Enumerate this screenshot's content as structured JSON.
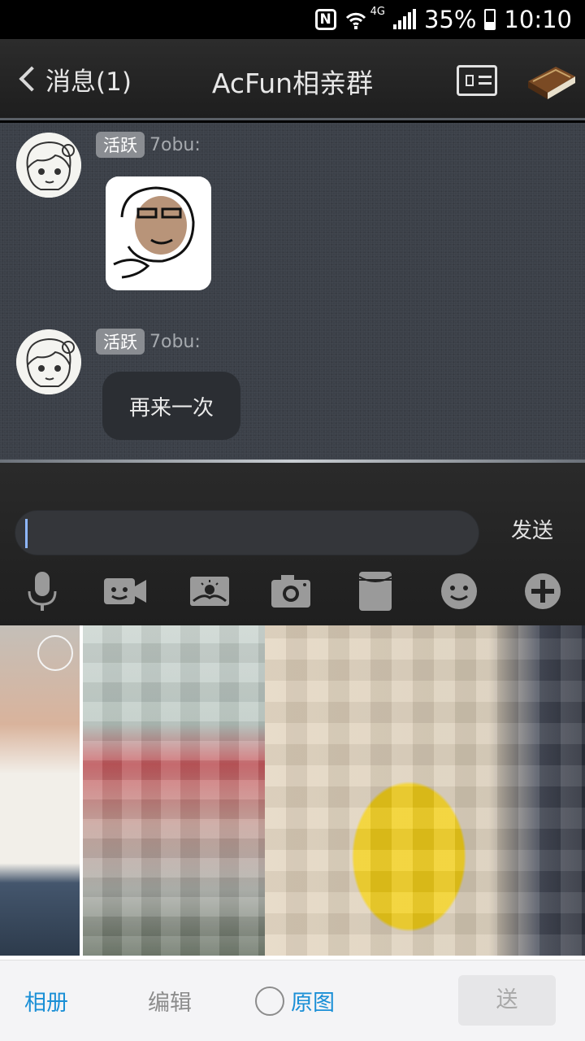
{
  "status_bar": {
    "nfc_label": "N",
    "network_type": "4G",
    "battery": "35%",
    "time": "10:10"
  },
  "header": {
    "back_label": "消息(1)",
    "title": "AcFun相亲群",
    "icons": [
      "contact-card-icon",
      "book-icon"
    ]
  },
  "chat": {
    "messages": [
      {
        "badge": "活跃",
        "sender": "7obu:",
        "type": "sticker"
      },
      {
        "badge": "活跃",
        "sender": "7obu:",
        "type": "text",
        "text": "再来一次"
      }
    ]
  },
  "composer": {
    "input_value": "",
    "send_label": "发送",
    "tools": [
      "microphone-icon",
      "video-icon",
      "image-icon",
      "camera-icon",
      "folder-icon",
      "emoji-icon",
      "plus-icon"
    ]
  },
  "photo_picker": {
    "photo_count": 3,
    "bottom": {
      "album_label": "相册",
      "edit_label": "编辑",
      "original_label": "原图",
      "send_label": "送"
    }
  },
  "colors": {
    "accent": "#1a8fd6",
    "chat_background": "#3b4048",
    "header_background": "#262626"
  }
}
